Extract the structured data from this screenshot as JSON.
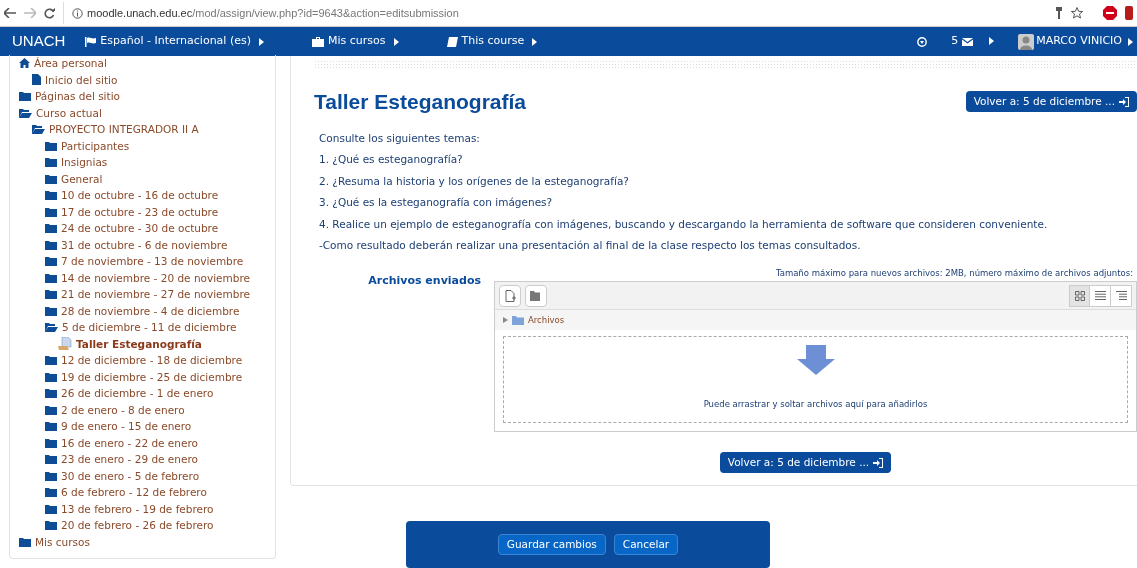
{
  "browser": {
    "url_host": "moodle.unach.edu.ec",
    "url_path": "/mod/assign/view.php?id=9643&action=editsubmission"
  },
  "navbar": {
    "brand": "UNACH",
    "menus": [
      "Español - Internacional (es)",
      "Mis cursos",
      "This course"
    ],
    "messages_count": "5",
    "user": "MARCO VINICIO"
  },
  "sidebar": {
    "items": [
      {
        "label": "Área personal",
        "kind": "home",
        "children": [
          {
            "label": "Inicio del sitio",
            "kind": "page"
          }
        ]
      },
      {
        "label": "Páginas del sitio",
        "kind": "folder",
        "expanded": false
      },
      {
        "label": "Curso actual",
        "kind": "folder",
        "expanded": true,
        "children": [
          {
            "label": "PROYECTO INTEGRADOR II A",
            "kind": "folder",
            "expanded": true,
            "children": [
              {
                "label": "Participantes",
                "kind": "folder",
                "expanded": false
              },
              {
                "label": "Insignias",
                "kind": "folder",
                "expanded": false
              },
              {
                "label": "General",
                "kind": "folder",
                "expanded": false
              },
              {
                "label": "10 de octubre - 16 de octubre",
                "kind": "folder",
                "expanded": false
              },
              {
                "label": "17 de octubre - 23 de octubre",
                "kind": "folder",
                "expanded": false
              },
              {
                "label": "24 de octubre - 30 de octubre",
                "kind": "folder",
                "expanded": false
              },
              {
                "label": "31 de octubre - 6 de noviembre",
                "kind": "folder",
                "expanded": false
              },
              {
                "label": "7 de noviembre - 13 de noviembre",
                "kind": "folder",
                "expanded": false
              },
              {
                "label": "14 de noviembre - 20 de noviembre",
                "kind": "folder",
                "expanded": false
              },
              {
                "label": "21 de noviembre - 27 de noviembre",
                "kind": "folder",
                "expanded": false
              },
              {
                "label": "28 de noviembre - 4 de diciembre",
                "kind": "folder",
                "expanded": false
              },
              {
                "label": "5 de diciembre - 11 de diciembre",
                "kind": "folder",
                "expanded": true,
                "children": [
                  {
                    "label": "Taller Esteganografía",
                    "kind": "activity",
                    "selected": true
                  }
                ]
              },
              {
                "label": "12 de diciembre - 18 de diciembre",
                "kind": "folder",
                "expanded": false
              },
              {
                "label": "19 de diciembre - 25 de diciembre",
                "kind": "folder",
                "expanded": false
              },
              {
                "label": "26 de diciembre - 1 de enero",
                "kind": "folder",
                "expanded": false
              },
              {
                "label": "2 de enero - 8 de enero",
                "kind": "folder",
                "expanded": false
              },
              {
                "label": "9 de enero - 15 de enero",
                "kind": "folder",
                "expanded": false
              },
              {
                "label": "16 de enero - 22 de enero",
                "kind": "folder",
                "expanded": false
              },
              {
                "label": "23 de enero - 29 de enero",
                "kind": "folder",
                "expanded": false
              },
              {
                "label": "30 de enero - 5 de febrero",
                "kind": "folder",
                "expanded": false
              },
              {
                "label": "6 de febrero - 12 de febrero",
                "kind": "folder",
                "expanded": false
              },
              {
                "label": "13 de febrero - 19 de febrero",
                "kind": "folder",
                "expanded": false
              },
              {
                "label": "20 de febrero - 26 de febrero",
                "kind": "folder",
                "expanded": false
              }
            ]
          }
        ]
      },
      {
        "label": "Mis cursos",
        "kind": "folder",
        "expanded": false
      }
    ]
  },
  "main": {
    "title": "Taller Esteganografía",
    "back_button": "Volver a: 5 de diciembre ...",
    "paragraphs": [
      "Consulte los siguientes temas:",
      "1. ¿Qué es esteganografía?",
      "2. ¿Resuma la historia y los orígenes de la esteganografía?",
      "3. ¿Qué es la esteganografía con imágenes?",
      "4. Realice un ejemplo de esteganografía con imágenes, buscando y descargando la herramienta de software que consideren conveniente.",
      "-Como resultado deberán realizar una presentación al final de la clase respecto los temas consultados."
    ],
    "files_label": "Archivos enviados",
    "files_limits": "Tamaño máximo para nuevos archivos: 2MB, número máximo de archivos adjuntos:",
    "folder": "Archivos",
    "drop_hint": "Puede arrastrar y soltar archivos aquí para añadirlos",
    "back_button_bottom": "Volver a: 5 de diciembre ..."
  },
  "actions": [
    "Guardar cambios",
    "Cancelar"
  ]
}
